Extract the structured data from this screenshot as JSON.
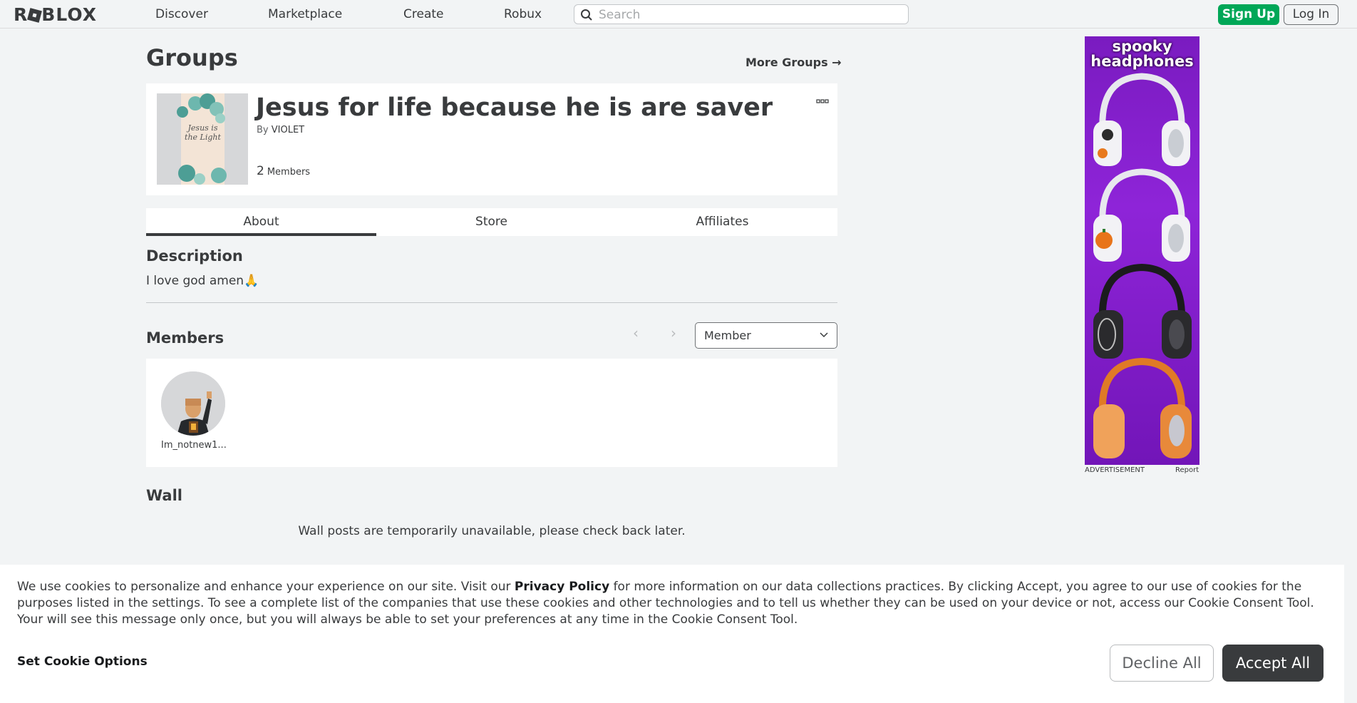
{
  "nav": {
    "logo": "ROBLOX",
    "links": [
      "Discover",
      "Marketplace",
      "Create",
      "Robux"
    ],
    "search_placeholder": "Search",
    "signup": "Sign Up",
    "login": "Log In"
  },
  "page": {
    "title": "Groups",
    "more_groups": "More Groups →"
  },
  "group": {
    "name": "Jesus for life because he is are saver",
    "by_prefix": "By",
    "owner": "VIOLET",
    "member_count": "2",
    "members_label": "Members",
    "thumb_text": "Jesus is the Light"
  },
  "tabs": [
    "About",
    "Store",
    "Affiliates"
  ],
  "about": {
    "description_title": "Description",
    "description": "I love god amen🙏"
  },
  "members": {
    "title": "Members",
    "role_selected": "Member",
    "list": [
      {
        "name": "Im_notnew1..."
      }
    ]
  },
  "wall": {
    "title": "Wall",
    "message": "Wall posts are temporarily unavailable, please check back later."
  },
  "ad": {
    "title_line1": "spooky",
    "title_line2": "headphones",
    "label": "ADVERTISEMENT",
    "report": "Report"
  },
  "cookie": {
    "text_before": "We use cookies to personalize and enhance your experience on our site. Visit our ",
    "privacy_link": "Privacy Policy",
    "text_after": " for more information on our data collections practices. By clicking Accept, you agree to our use of cookies for the purposes listed in the settings. To see a complete list of the companies that use these cookies and other technologies and to tell us whether they can be used on your device or not, access our Cookie Consent Tool. Your will see this message only once, but you will always be able to set your preferences at any time in the Cookie Consent Tool.",
    "options": "Set Cookie Options",
    "decline": "Decline All",
    "accept": "Accept All"
  },
  "colors": {
    "accent_green": "#00a757",
    "text_dark": "#393b3d",
    "background": "#f2f4f5",
    "ad_purple": "#8e24d8"
  }
}
